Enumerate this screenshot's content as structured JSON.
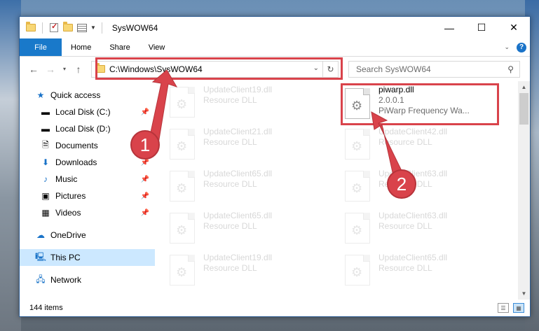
{
  "window": {
    "title": "SysWOW64",
    "controls": {
      "minimize": "—",
      "maximize": "☐",
      "close": "✕"
    }
  },
  "ribbon": {
    "tabs": [
      "File",
      "Home",
      "Share",
      "View"
    ],
    "help": "?"
  },
  "address_bar": {
    "path": "C:\\Windows\\SysWOW64",
    "search_placeholder": "Search SysWOW64"
  },
  "navigation": {
    "quick_access": "Quick access",
    "items": [
      {
        "label": "Local Disk (C:)",
        "icon": "drive-icon",
        "pinned": true
      },
      {
        "label": "Local Disk (D:)",
        "icon": "drive-icon",
        "pinned": false
      },
      {
        "label": "Documents",
        "icon": "documents-icon",
        "pinned": true
      },
      {
        "label": "Downloads",
        "icon": "downloads-icon",
        "pinned": true
      },
      {
        "label": "Music",
        "icon": "music-icon",
        "pinned": true
      },
      {
        "label": "Pictures",
        "icon": "pictures-icon",
        "pinned": true
      },
      {
        "label": "Videos",
        "icon": "videos-icon",
        "pinned": true
      }
    ],
    "onedrive": "OneDrive",
    "this_pc": "This PC",
    "network": "Network"
  },
  "files": {
    "left_column": [
      {
        "name": "UpdateClient19.dll",
        "sub": "Resource DLL"
      },
      {
        "name": "UpdateClient21.dll",
        "sub": "Resource DLL"
      },
      {
        "name": "UpdateClient65.dll",
        "sub": "Resource DLL"
      },
      {
        "name": "UpdateClient65.dll",
        "sub": "Resource DLL"
      },
      {
        "name": "UpdateClient19.dll",
        "sub": "Resource DLL"
      }
    ],
    "right_column": [
      {
        "name": "UpdateClient42.dll",
        "sub": "Resource DLL"
      },
      {
        "name": "UpdateClient63.dll",
        "sub": "Resource DLL"
      },
      {
        "name": "UpdateClient63.dll",
        "sub": "Resource DLL"
      },
      {
        "name": "UpdateClient65.dll",
        "sub": "Resource DLL"
      }
    ],
    "highlighted": {
      "name": "piwarp.dll",
      "version": "2.0.0.1",
      "description": "PiWarp Frequency Wa..."
    }
  },
  "status": {
    "items": "144 items"
  },
  "callouts": {
    "one": "1",
    "two": "2"
  },
  "colors": {
    "accent": "#1979ca",
    "highlight": "#d9434b",
    "selection": "#cce8ff"
  }
}
